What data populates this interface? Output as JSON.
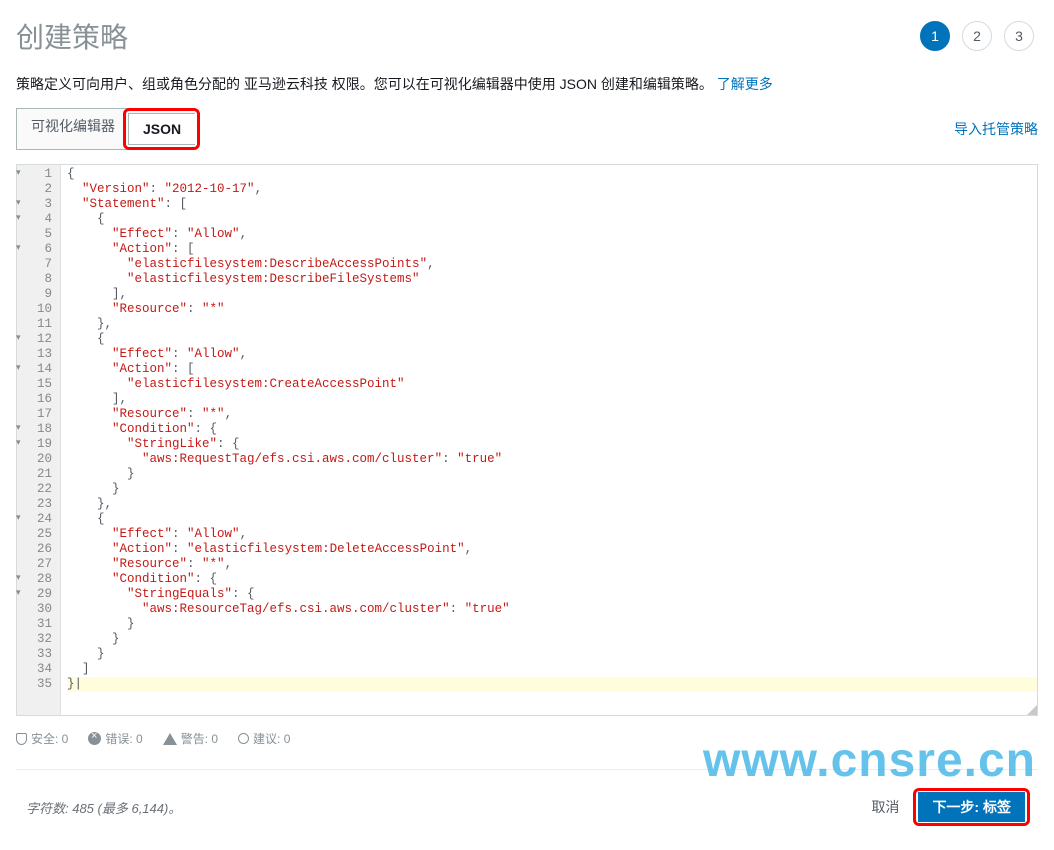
{
  "header": {
    "title": "创建策略",
    "steps": [
      "1",
      "2",
      "3"
    ],
    "active_step": 0
  },
  "description": {
    "text": "策略定义可向用户、组或角色分配的 亚马逊云科技 权限。您可以在可视化编辑器中使用 JSON 创建和编辑策略。",
    "learn_more": "了解更多"
  },
  "tabs": {
    "visual": "可视化编辑器",
    "json": "JSON",
    "active": "json"
  },
  "import_link": "导入托管策略",
  "code": {
    "lines": [
      {
        "n": 1,
        "fold": true,
        "t": "{"
      },
      {
        "n": 2,
        "t": "  \"Version\": \"2012-10-17\","
      },
      {
        "n": 3,
        "fold": true,
        "t": "  \"Statement\": ["
      },
      {
        "n": 4,
        "fold": true,
        "t": "    {"
      },
      {
        "n": 5,
        "t": "      \"Effect\": \"Allow\","
      },
      {
        "n": 6,
        "fold": true,
        "t": "      \"Action\": ["
      },
      {
        "n": 7,
        "t": "        \"elasticfilesystem:DescribeAccessPoints\","
      },
      {
        "n": 8,
        "t": "        \"elasticfilesystem:DescribeFileSystems\""
      },
      {
        "n": 9,
        "t": "      ],"
      },
      {
        "n": 10,
        "t": "      \"Resource\": \"*\""
      },
      {
        "n": 11,
        "t": "    },"
      },
      {
        "n": 12,
        "fold": true,
        "t": "    {"
      },
      {
        "n": 13,
        "t": "      \"Effect\": \"Allow\","
      },
      {
        "n": 14,
        "fold": true,
        "t": "      \"Action\": ["
      },
      {
        "n": 15,
        "t": "        \"elasticfilesystem:CreateAccessPoint\""
      },
      {
        "n": 16,
        "t": "      ],"
      },
      {
        "n": 17,
        "t": "      \"Resource\": \"*\","
      },
      {
        "n": 18,
        "fold": true,
        "t": "      \"Condition\": {"
      },
      {
        "n": 19,
        "fold": true,
        "t": "        \"StringLike\": {"
      },
      {
        "n": 20,
        "t": "          \"aws:RequestTag/efs.csi.aws.com/cluster\": \"true\""
      },
      {
        "n": 21,
        "t": "        }"
      },
      {
        "n": 22,
        "t": "      }"
      },
      {
        "n": 23,
        "t": "    },"
      },
      {
        "n": 24,
        "fold": true,
        "t": "    {"
      },
      {
        "n": 25,
        "t": "      \"Effect\": \"Allow\","
      },
      {
        "n": 26,
        "t": "      \"Action\": \"elasticfilesystem:DeleteAccessPoint\","
      },
      {
        "n": 27,
        "t": "      \"Resource\": \"*\","
      },
      {
        "n": 28,
        "fold": true,
        "t": "      \"Condition\": {"
      },
      {
        "n": 29,
        "fold": true,
        "t": "        \"StringEquals\": {"
      },
      {
        "n": 30,
        "t": "          \"aws:ResourceTag/efs.csi.aws.com/cluster\": \"true\""
      },
      {
        "n": 31,
        "t": "        }"
      },
      {
        "n": 32,
        "t": "      }"
      },
      {
        "n": 33,
        "t": "    }"
      },
      {
        "n": 34,
        "t": "  ]"
      },
      {
        "n": 35,
        "hl": true,
        "t": "}|"
      }
    ]
  },
  "status": {
    "security": "安全: 0",
    "errors": "错误: 0",
    "warnings": "警告: 0",
    "hints": "建议: 0"
  },
  "footer": {
    "charcount": "字符数: 485 (最多 6,144)。",
    "cancel": "取消",
    "next": "下一步: 标签"
  },
  "watermark": "www.cnsre.cn"
}
